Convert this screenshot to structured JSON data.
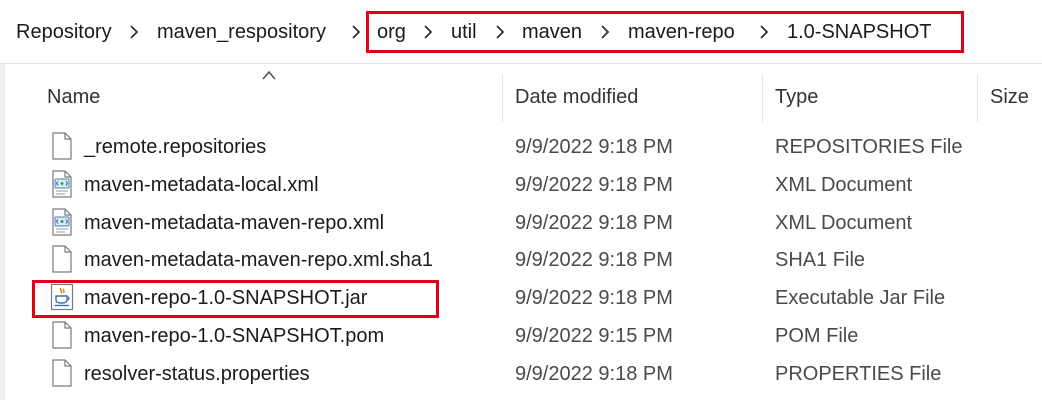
{
  "breadcrumb": {
    "items": [
      {
        "label": "Repository"
      },
      {
        "label": "maven_respository"
      },
      {
        "label": "org"
      },
      {
        "label": "util"
      },
      {
        "label": "maven"
      },
      {
        "label": "maven-repo"
      },
      {
        "label": "1.0-SNAPSHOT"
      }
    ]
  },
  "columns": {
    "name": "Name",
    "date": "Date modified",
    "type": "Type",
    "size": "Size"
  },
  "files": [
    {
      "name": "_remote.repositories",
      "date": "9/9/2022 9:18 PM",
      "type": "REPOSITORIES File",
      "icon": "blank-file-icon"
    },
    {
      "name": "maven-metadata-local.xml",
      "date": "9/9/2022 9:18 PM",
      "type": "XML Document",
      "icon": "xml-file-icon"
    },
    {
      "name": "maven-metadata-maven-repo.xml",
      "date": "9/9/2022 9:18 PM",
      "type": "XML Document",
      "icon": "xml-file-icon"
    },
    {
      "name": "maven-metadata-maven-repo.xml.sha1",
      "date": "9/9/2022 9:18 PM",
      "type": "SHA1 File",
      "icon": "blank-file-icon"
    },
    {
      "name": "maven-repo-1.0-SNAPSHOT.jar",
      "date": "9/9/2022 9:18 PM",
      "type": "Executable Jar File",
      "icon": "java-jar-icon"
    },
    {
      "name": "maven-repo-1.0-SNAPSHOT.pom",
      "date": "9/9/2022 9:15 PM",
      "type": "POM File",
      "icon": "blank-file-icon"
    },
    {
      "name": "resolver-status.properties",
      "date": "9/9/2022 9:18 PM",
      "type": "PROPERTIES File",
      "icon": "blank-file-icon"
    }
  ],
  "colors": {
    "highlight": "#e0001b",
    "text": "#1b1b1b"
  }
}
